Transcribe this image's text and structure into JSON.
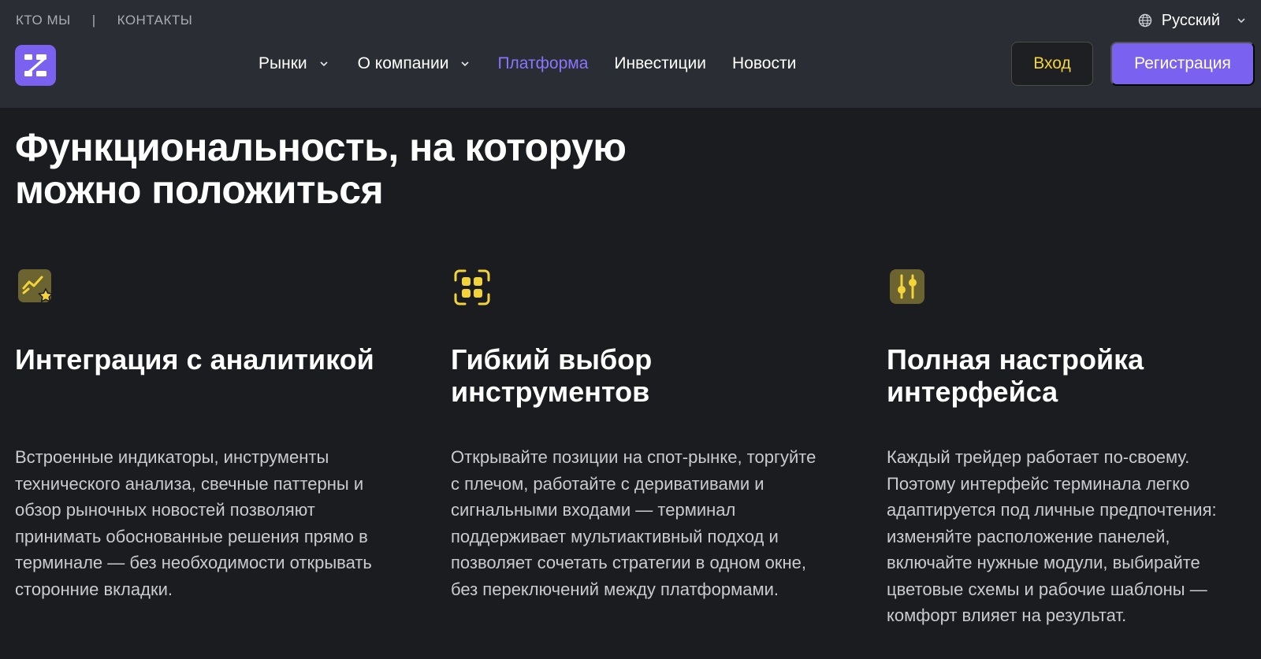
{
  "topbar": {
    "about": "КТО МЫ",
    "separator": "|",
    "contacts": "КОНТАКТЫ"
  },
  "language": {
    "icon": "globe-icon",
    "label": "Русский"
  },
  "logo": {
    "icon": "brand-logo-icon",
    "color": "#7b61f0"
  },
  "nav": {
    "items": [
      {
        "label": "Рынки",
        "has_dropdown": true
      },
      {
        "label": "О компании",
        "has_dropdown": true
      },
      {
        "label": "Платформа",
        "active": true
      },
      {
        "label": "Инвестиции"
      },
      {
        "label": "Новости"
      }
    ]
  },
  "actions": {
    "login": "Вход",
    "register": "Регистрация"
  },
  "headline": "Функциональность, на которую можно положиться",
  "features": [
    {
      "icon": "analytics-chart-star-icon",
      "title": "Интеграция с аналитикой",
      "text": "Встроенные индикаторы, инструменты технического анализа, свечные паттерны и обзор рыночных новостей позволяют принимать обоснованные решения прямо в терминале — без необходимости открывать сторонние вкладки."
    },
    {
      "icon": "grid-scan-icon",
      "title": "Гибкий выбор инструментов",
      "text": "Открывайте позиции на спот-рынке, торгуйте с плечом, работайте с деривативами и сигнальными входами — терминал поддерживает мультиактивный подход и позволяет сочетать стратегии в одном окне, без переключений между платформами."
    },
    {
      "icon": "sliders-icon",
      "title": "Полная настройка интерфейса",
      "text": "Каждый трейдер работает по-своему. Поэтому интерфейс терминала легко адаптируется под личные предпочтения: изменяйте расположение панелей, включайте нужные модули, выбирайте цветовые схемы и рабочие шаблоны — комфорт влияет на результат."
    }
  ],
  "colors": {
    "accent": "#7b61f0",
    "active_nav": "#8b74ff",
    "login_text": "#f2d33a",
    "icon_yellow": "#f2d33a",
    "icon_bg": "#6b6330",
    "background": "#1a1c20",
    "header_bg": "#2a2d33"
  }
}
